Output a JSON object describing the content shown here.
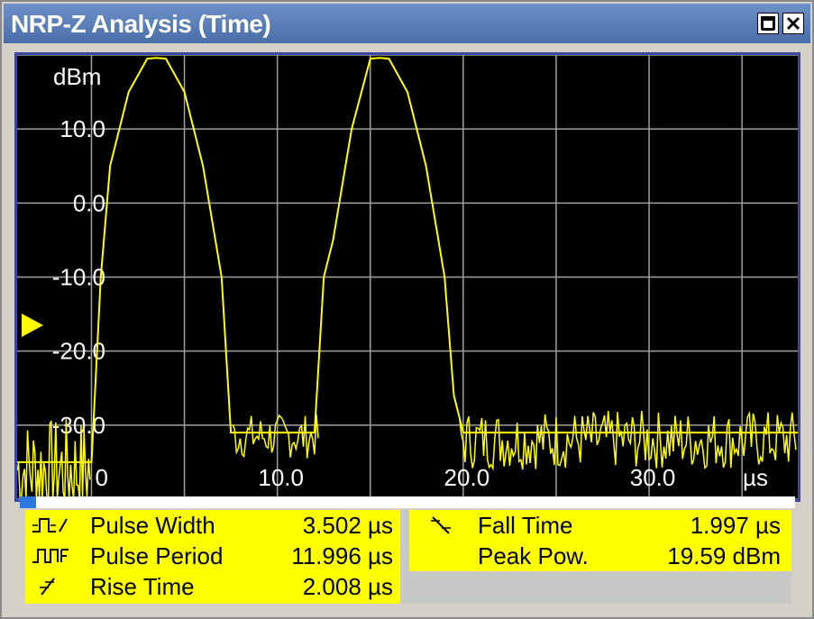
{
  "window": {
    "title": "NRP-Z Analysis (Time)"
  },
  "plot": {
    "y_unit": "dBm",
    "x_unit": "µs",
    "y_ticks": [
      "10.0",
      "0.0",
      "-10.0",
      "-20.0",
      "-30.0"
    ],
    "x_ticks": [
      "0",
      "10.0",
      "20.0",
      "30.0"
    ],
    "trace_color": "#ffff00",
    "grid_color": "#a0a0a0",
    "reference_marker_color": "#ffff00"
  },
  "chart_data": {
    "type": "line",
    "xlabel": "µs",
    "ylabel": "dBm",
    "xlim": [
      -4,
      38
    ],
    "ylim": [
      -40,
      20
    ],
    "grid": true,
    "series": [
      {
        "values_x": [
          -4,
          -2,
          0,
          0.5,
          1,
          2,
          3,
          3.5,
          4,
          5,
          6,
          7,
          7.5,
          8,
          8.5,
          10,
          11,
          12,
          12.5,
          13,
          14,
          15,
          15.5,
          16,
          17,
          18,
          19,
          19.5,
          20,
          21,
          25,
          30,
          35,
          38
        ],
        "values_y": [
          -35,
          -35,
          -35,
          -10,
          5,
          15,
          19.5,
          19.6,
          19.5,
          15,
          5,
          -10,
          -31,
          -31,
          -31,
          -31,
          -31,
          -31,
          -10,
          -5,
          10,
          19.5,
          19.6,
          19.5,
          15,
          5,
          -10,
          -26,
          -31,
          -31,
          -31,
          -31,
          -31,
          -31
        ]
      }
    ]
  },
  "results": {
    "pulse_width": {
      "label": "Pulse Width",
      "value": "3.502 µs",
      "icon": "pulse-width-icon"
    },
    "pulse_period": {
      "label": "Pulse Period",
      "value": "11.996 µs",
      "icon": "pulse-period-icon"
    },
    "rise_time": {
      "label": "Rise Time",
      "value": "2.008 µs",
      "icon": "rise-time-icon"
    },
    "fall_time": {
      "label": "Fall Time",
      "value": "1.997 µs",
      "icon": "fall-time-icon"
    },
    "peak_power": {
      "label": "Peak Pow.",
      "value": "19.59 dBm"
    }
  }
}
